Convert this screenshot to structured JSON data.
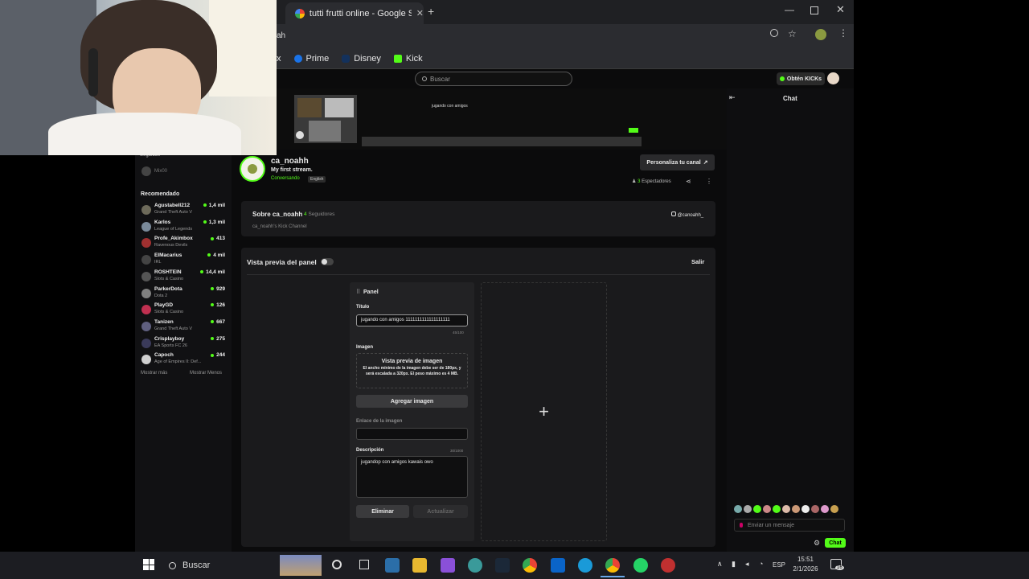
{
  "browser": {
    "tab_title": "tutti frutti online - Google Sea",
    "address": "ah",
    "bookmarks": [
      "x",
      "Prime",
      "Disney",
      "Kick"
    ]
  },
  "site": {
    "search_placeholder": "Buscar",
    "get_kicks": "Obtén KICKs",
    "chat_title": "Chat",
    "strip_caption": "jugando con amigos"
  },
  "sidebar": {
    "following_label": "Seguidos",
    "following_user": "Mix00",
    "recommended_label": "Recomendado",
    "items": [
      {
        "name": "Agustabell212",
        "category": "Grand Theft Auto V",
        "viewers": "1,4 mil",
        "color": "#6d6a5a"
      },
      {
        "name": "Karlos",
        "category": "League of Legends",
        "viewers": "1,3 mil",
        "color": "#7a8a9a"
      },
      {
        "name": "Profe_Akimbox",
        "category": "Ravenous Devils",
        "viewers": "413",
        "color": "#a03030"
      },
      {
        "name": "ElMacarius",
        "category": "IRL",
        "viewers": "4 mil",
        "color": "#444444"
      },
      {
        "name": "ROSHTEIN",
        "category": "Slots & Casino",
        "viewers": "14,4 mil",
        "color": "#555555"
      },
      {
        "name": "ParkerDota",
        "category": "Dota 2",
        "viewers": "929",
        "color": "#808080"
      },
      {
        "name": "PlayGD",
        "category": "Slots & Casino",
        "viewers": "126",
        "color": "#c03050"
      },
      {
        "name": "Tanizen",
        "category": "Grand Theft Auto V",
        "viewers": "667",
        "color": "#606080"
      },
      {
        "name": "Crisplayboy",
        "category": "EA Sports FC 26",
        "viewers": "275",
        "color": "#3a3a5a"
      },
      {
        "name": "Capoch",
        "category": "Age of Empires II: Def...",
        "viewers": "244",
        "color": "#d0d0d0"
      }
    ],
    "show_more": "Mostrar más",
    "show_less": "Mostrar Menos"
  },
  "channel": {
    "name": "ca_noahh",
    "title": "My first stream.",
    "category": "Conversando",
    "language": "English",
    "customize_button": "Personaliza tu canal",
    "viewers": "3",
    "viewers_label": "Espectadores",
    "about_title": "Sobre ca_noahh",
    "followers": "4",
    "followers_label": "Seguidores",
    "about_desc": "ca_noahh's Kick Channel",
    "instagram": "@canoahh_"
  },
  "panel_preview": {
    "label": "Vista previa del panel",
    "exit_button": "Salir",
    "panel_header": "Panel",
    "title_label": "Título",
    "title_value": "jugando con amigos 1111111111111111111",
    "title_count": "45/100",
    "image_label": "Imagen",
    "image_preview_title": "Vista previa de imagen",
    "image_preview_desc": "El ancho mínimo de la imagen debe ser de 180px, y será escalada a 320px. El peso máximo es 4 MB.",
    "add_image_button": "Agregar imagen",
    "link_label": "Enlace de la imagen",
    "desc_label": "Descripción",
    "desc_count": "30/1000",
    "desc_value": "jugandop con amigos kawais owo",
    "delete_button": "Eliminar",
    "update_button": "Actualizar",
    "add_panel_glyph": "+"
  },
  "chat": {
    "placeholder": "Enviar un mensaje",
    "send_button": "Chat"
  },
  "taskbar": {
    "search_label": "Buscar",
    "lang": "ESP",
    "time": "15:51",
    "date": "2/1/2026",
    "notif_count": "16"
  },
  "colors": {
    "kick_green": "#53fc18",
    "accent": "#53fc18"
  }
}
